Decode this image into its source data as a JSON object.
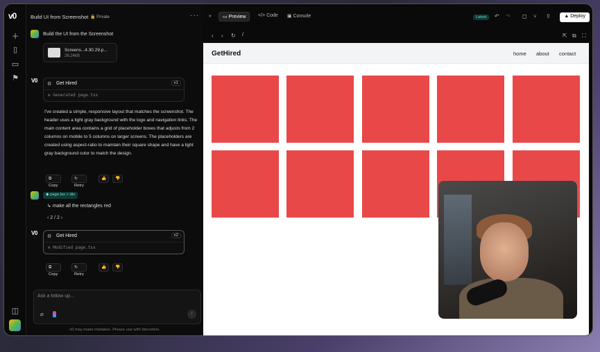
{
  "rail": {
    "logo": "v0",
    "icons": [
      "plus-icon",
      "book-icon",
      "folder-icon",
      "flag-icon",
      "sidebar-icon"
    ]
  },
  "chat": {
    "title": "Build UI from Screenshot",
    "privacy": "Private",
    "user_message_1": "Build the UI from the Screenshot",
    "attachment": {
      "name": "Screens...4.30.29.p...",
      "size": "26.24kB"
    },
    "gen1": {
      "name": "Get Hired",
      "version": "v1",
      "file": "Generated page.tsx"
    },
    "description": "I've created a simple, responsive layout that matches the screenshot. The header uses a light gray background with the logo and navigation links. The main content area contains a grid of placeholder boxes that adjusts from 2 columns on mobile to 5 columns on larger screens. The placeholders are created using aspect-ratio to maintain their square shape and have a light gray background color to match the design.",
    "actions": {
      "copy": "Copy",
      "retry": "Retry"
    },
    "crumb": "page.tsx > div",
    "user_message_2": "make all the rectangles red",
    "pager": "2 / 2",
    "gen2": {
      "name": "Get Hired",
      "version": "v2",
      "file": "Modified page.tsx"
    },
    "input_placeholder": "Ask a follow up...",
    "disclaimer": "v0 may make mistakes. Please use with discretion."
  },
  "toolbar": {
    "preview": "Preview",
    "code": "Code",
    "console": "Console",
    "latest": "Latest",
    "deploy": "Deploy",
    "path": "/"
  },
  "site": {
    "logo": "GetHired",
    "nav": [
      "home",
      "about",
      "contact"
    ],
    "box_color": "#e94848"
  }
}
